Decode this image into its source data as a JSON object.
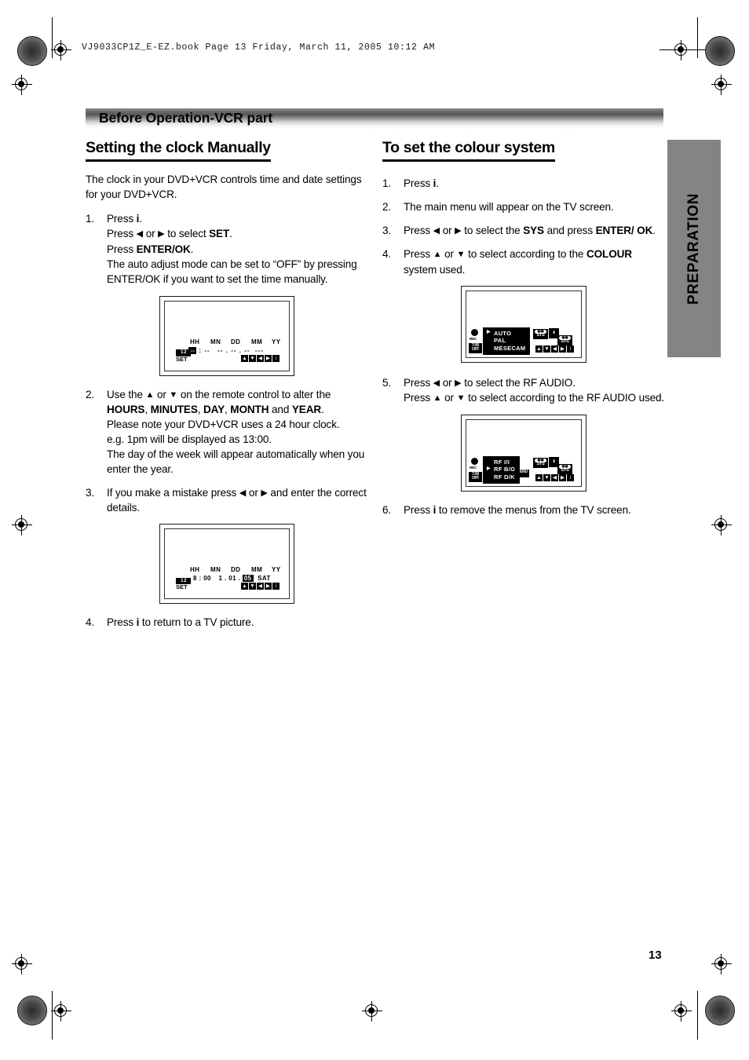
{
  "document": {
    "running_head": "VJ9033CP1Z_E-EZ.book   Page 13   Friday, March 11, 2005   10:12 AM",
    "chapter_band": "Before Operation-VCR part",
    "side_tab": "PREPARATION",
    "page_number": "13"
  },
  "left_column": {
    "heading": "Setting the clock Manually",
    "intro": "The clock in your DVD+VCR controls time and date settings for your DVD+VCR.",
    "steps": [
      {
        "num": "1.",
        "lines": [
          "Press i.",
          "Press ◀ or ▶ to select SET.",
          "Press ENTER/OK.",
          "The auto adjust mode can be set to “OFF” by pressing ENTER/OK if you want to set the time manually."
        ]
      },
      {
        "num": "2.",
        "lines": [
          "Use the ▲ or ▼ on the remote control to alter the HOURS, MINUTES, DAY, MONTH and YEAR.",
          "Please note your DVD+VCR uses a 24 hour clock.",
          "e.g. 1pm will be displayed as 13:00.",
          "The day of the week will appear automatically when you enter the year."
        ]
      },
      {
        "num": "3.",
        "lines": [
          "If you make a mistake press ◀ or ▶ and enter the correct details."
        ]
      },
      {
        "num": "4.",
        "lines": [
          "Press i to return to a TV picture."
        ]
      }
    ]
  },
  "right_column": {
    "heading": "To set the colour system",
    "steps": [
      {
        "num": "1.",
        "lines": [
          "Press i."
        ]
      },
      {
        "num": "2.",
        "lines": [
          "The main menu will appear on the TV screen."
        ]
      },
      {
        "num": "3.",
        "lines": [
          "Press ◀ or ▶ to select the SYS and press ENTER/OK."
        ]
      },
      {
        "num": "4.",
        "lines": [
          "Press ▲ or ▼ to select according to the COLOUR system used."
        ]
      },
      {
        "num": "5.",
        "lines": [
          "Press ◀ or ▶ to select the RF AUDIO.",
          "Press ▲ or ▼ to select according to the RF AUDIO used."
        ]
      },
      {
        "num": "6.",
        "lines": [
          "Press i to remove the menus from the TV screen."
        ]
      }
    ]
  },
  "figures": {
    "clock_empty": {
      "headers": [
        "HH",
        "MN",
        "DD",
        "MM",
        "YY"
      ],
      "values": [
        "--",
        ":",
        "--",
        "--",
        ".",
        "--",
        ".",
        "--",
        "---"
      ],
      "highlight_index": 0,
      "set_label": "SET",
      "set_glyph": "1 2",
      "nav_keys": [
        "▲",
        "▼",
        "◀",
        "▶",
        "i"
      ]
    },
    "clock_filled": {
      "headers": [
        "HH",
        "MN",
        "DD",
        "MM",
        "YY"
      ],
      "hours": "8",
      "colon": ":",
      "minutes": "00",
      "day": "1",
      "dot1": ".",
      "month": "01",
      "dot2": ".",
      "year": "05",
      "weekday": "SAT",
      "highlight": "year",
      "set_label": "SET",
      "set_glyph": "1 2",
      "nav_keys": [
        "▲",
        "▼",
        "◀",
        "▶",
        "i"
      ]
    },
    "colour_system_menu": {
      "options": [
        "AUTO",
        "PAL",
        "MESECAM"
      ],
      "selected": "AUTO",
      "icons": [
        "REC",
        "TIMER",
        "OFF",
        "SYS",
        "RF"
      ],
      "sys_icon_label": "SYS",
      "nav_keys": [
        "▲",
        "▼",
        "◀",
        "▶",
        "i"
      ]
    },
    "rf_audio_menu": {
      "options": [
        "RF I/I",
        "RF B/G",
        "RF D/K"
      ],
      "selected": "RF B/G",
      "icons": [
        "REC",
        "TIMER",
        "OFF",
        "SYS",
        "RF"
      ],
      "sys_icon_label": "SYS",
      "nav_keys": [
        "▲",
        "▼",
        "◀",
        "▶",
        "i"
      ]
    }
  }
}
